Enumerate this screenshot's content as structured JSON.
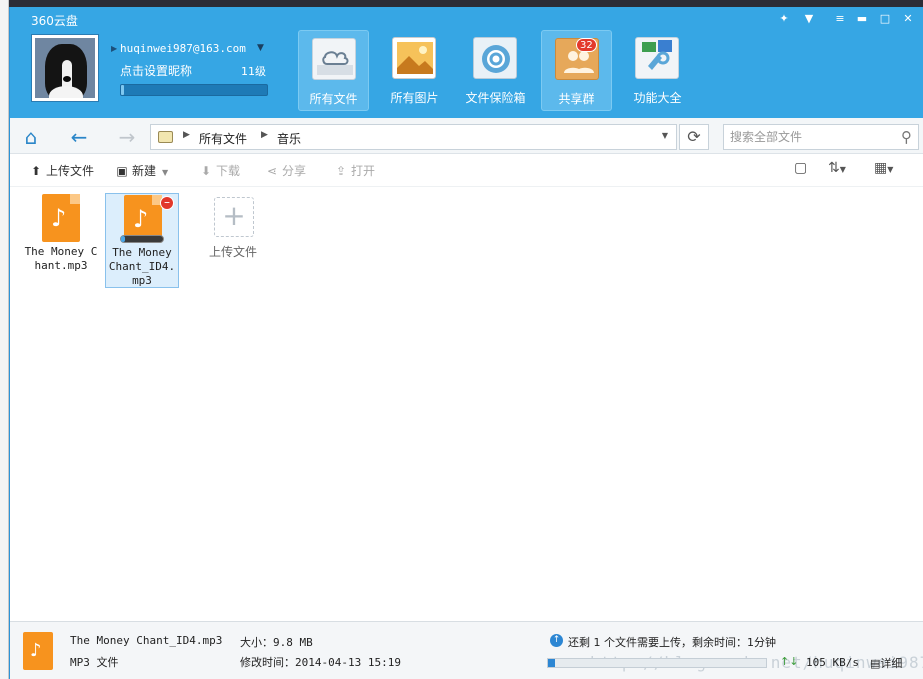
{
  "app": {
    "title": "360云盘"
  },
  "window_controls": [
    "gift-icon",
    "tshirt-icon",
    "menu-icon",
    "minimize-icon",
    "maximize-icon",
    "close-icon"
  ],
  "user": {
    "email": "huqinwei987@163.com",
    "nickname_prompt": "点击设置昵称",
    "level": "11级",
    "level_progress": 0.02
  },
  "nav": [
    {
      "label": "所有文件",
      "icon": "cloud-disk-icon",
      "active": true
    },
    {
      "label": "所有图片",
      "icon": "photo-icon",
      "active": false
    },
    {
      "label": "文件保险箱",
      "icon": "safe-icon",
      "active": false
    },
    {
      "label": "共享群",
      "icon": "group-icon",
      "active": false,
      "badge": "32"
    },
    {
      "label": "功能大全",
      "icon": "toolbox-icon",
      "active": false
    }
  ],
  "address": {
    "crumbs": [
      "所有文件",
      "音乐"
    ],
    "search_placeholder": "搜索全部文件"
  },
  "toolbar": {
    "upload": "上传文件",
    "new": "新建",
    "download": "下载",
    "share": "分享",
    "open": "打开"
  },
  "files": [
    {
      "name": "The Money Chant.mp3"
    },
    {
      "name": "The Money Chant_ID4.mp3",
      "selected": true,
      "upload_progress": 0.1
    }
  ],
  "upload_tile_label": "上传文件",
  "status": {
    "file_name": "The Money Chant_ID4.mp3",
    "file_type": "MP3 文件",
    "size": "大小：9.8 MB",
    "modified": "修改时间：2014-04-13 15:19",
    "upload_message": "还剩 1 个文件需要上传，剩余时间：1分钟",
    "speed": "105 KB/s",
    "detail": "详细",
    "watermark": "http://blog.csdn.net/huqinwei987"
  },
  "colors": {
    "brand": "#36a6e4",
    "file_orange": "#f7931e"
  }
}
